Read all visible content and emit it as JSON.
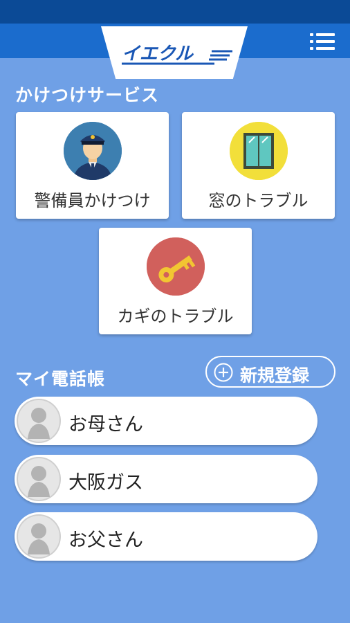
{
  "app": {
    "logo_text": "イエクル"
  },
  "services": {
    "title": "かけつけサービス",
    "items": [
      {
        "label": "警備員かけつけ",
        "icon": "security-guard-icon"
      },
      {
        "label": "窓のトラブル",
        "icon": "window-icon"
      },
      {
        "label": "カギのトラブル",
        "icon": "key-icon"
      }
    ]
  },
  "phonebook": {
    "title": "マイ電話帳",
    "register_label": "新規登録",
    "contacts": [
      {
        "name": "お母さん"
      },
      {
        "name": "大阪ガス"
      },
      {
        "name": "お父さん"
      }
    ]
  },
  "colors": {
    "background": "#6fa0e6",
    "status_bar": "#0b4a96",
    "app_bar": "#1b6ccd",
    "logo_blue": "#1a57b5"
  }
}
